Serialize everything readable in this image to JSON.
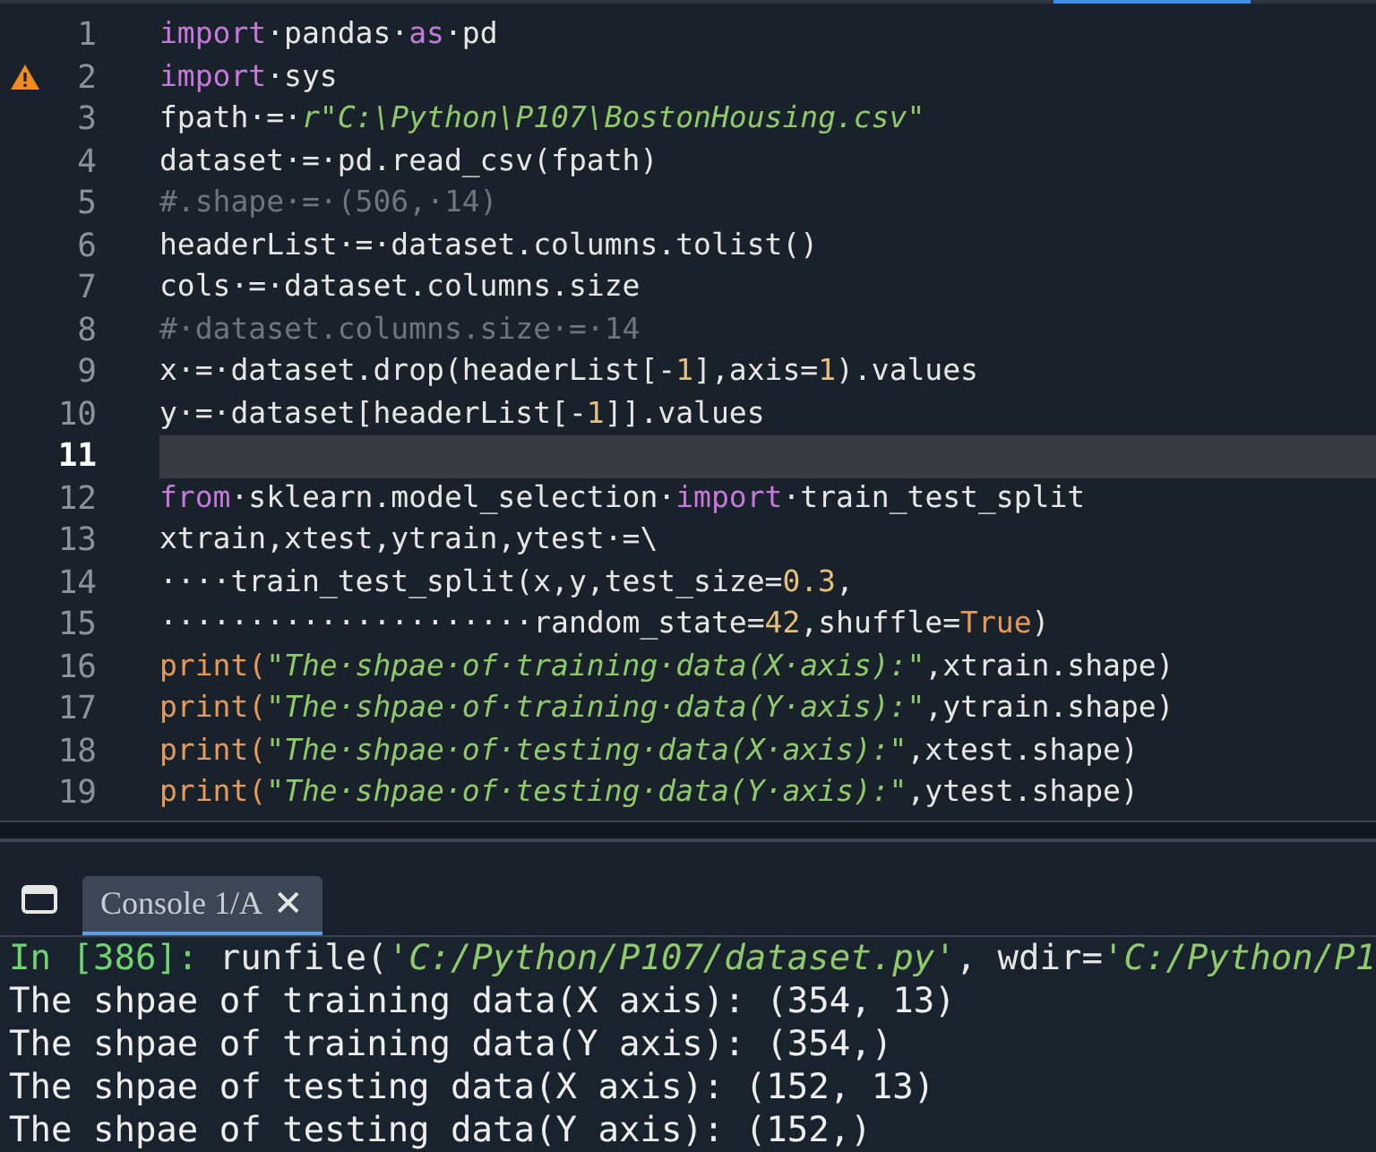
{
  "editor": {
    "lines": [
      {
        "number": "1",
        "warning": false,
        "current": false,
        "tokens": [
          {
            "kind": "keyword",
            "text": "import"
          },
          {
            "kind": "plain",
            "text": "·pandas·"
          },
          {
            "kind": "keyword",
            "text": "as"
          },
          {
            "kind": "plain",
            "text": "·pd"
          }
        ]
      },
      {
        "number": "2",
        "warning": true,
        "current": false,
        "tokens": [
          {
            "kind": "keyword",
            "text": "import"
          },
          {
            "kind": "plain",
            "text": "·sys"
          }
        ]
      },
      {
        "number": "3",
        "warning": false,
        "current": false,
        "tokens": [
          {
            "kind": "plain",
            "text": "fpath·=·"
          },
          {
            "kind": "string",
            "text": "r\"C:\\Python\\P107\\BostonHousing.csv\""
          }
        ]
      },
      {
        "number": "4",
        "warning": false,
        "current": false,
        "tokens": [
          {
            "kind": "plain",
            "text": "dataset·=·pd.read_csv(fpath)"
          }
        ]
      },
      {
        "number": "5",
        "warning": false,
        "current": false,
        "tokens": [
          {
            "kind": "comment",
            "text": "#.shape·=·(506,·14)"
          }
        ]
      },
      {
        "number": "6",
        "warning": false,
        "current": false,
        "tokens": [
          {
            "kind": "plain",
            "text": "headerList·=·dataset.columns.tolist()"
          }
        ]
      },
      {
        "number": "7",
        "warning": false,
        "current": false,
        "tokens": [
          {
            "kind": "plain",
            "text": "cols·=·dataset.columns.size"
          }
        ]
      },
      {
        "number": "8",
        "warning": false,
        "current": false,
        "tokens": [
          {
            "kind": "comment",
            "text": "#·dataset.columns.size·=·14"
          }
        ]
      },
      {
        "number": "9",
        "warning": false,
        "current": false,
        "tokens": [
          {
            "kind": "plain",
            "text": "x·=·dataset.drop(headerList[-"
          },
          {
            "kind": "number",
            "text": "1"
          },
          {
            "kind": "plain",
            "text": "],axis="
          },
          {
            "kind": "number",
            "text": "1"
          },
          {
            "kind": "plain",
            "text": ").values"
          }
        ]
      },
      {
        "number": "10",
        "warning": false,
        "current": false,
        "tokens": [
          {
            "kind": "plain",
            "text": "y·=·dataset[headerList[-"
          },
          {
            "kind": "number",
            "text": "1"
          },
          {
            "kind": "plain",
            "text": "]].values"
          }
        ]
      },
      {
        "number": "11",
        "warning": false,
        "current": true
      },
      {
        "number": "12",
        "warning": false,
        "current": false,
        "tokens": [
          {
            "kind": "keyword",
            "text": "from"
          },
          {
            "kind": "plain",
            "text": "·sklearn.model_selection·"
          },
          {
            "kind": "keyword",
            "text": "import"
          },
          {
            "kind": "plain",
            "text": "·train_test_split"
          }
        ]
      },
      {
        "number": "13",
        "warning": false,
        "current": false,
        "tokens": [
          {
            "kind": "plain",
            "text": "xtrain,xtest,ytrain,ytest·=\\"
          }
        ]
      },
      {
        "number": "14",
        "warning": false,
        "current": false,
        "tokens": [
          {
            "kind": "plain",
            "text": "····train_test_split(x,y,test_size="
          },
          {
            "kind": "number",
            "text": "0.3"
          },
          {
            "kind": "plain",
            "text": ","
          }
        ]
      },
      {
        "number": "15",
        "warning": false,
        "current": false,
        "tokens": [
          {
            "kind": "plain",
            "text": "·····················random_state="
          },
          {
            "kind": "number",
            "text": "42"
          },
          {
            "kind": "plain",
            "text": ",shuffle="
          },
          {
            "kind": "builtin",
            "text": "True"
          },
          {
            "kind": "plain",
            "text": ")"
          }
        ]
      },
      {
        "number": "16",
        "warning": false,
        "current": false,
        "tokens": [
          {
            "kind": "builtin",
            "text": "print("
          },
          {
            "kind": "string",
            "text": "\"The·shpae·of·training·data(X·axis):\""
          },
          {
            "kind": "plain",
            "text": ",xtrain.shape)"
          }
        ]
      },
      {
        "number": "17",
        "warning": false,
        "current": false,
        "tokens": [
          {
            "kind": "builtin",
            "text": "print("
          },
          {
            "kind": "string",
            "text": "\"The·shpae·of·training·data(Y·axis):\""
          },
          {
            "kind": "plain",
            "text": ",ytrain.shape)"
          }
        ]
      },
      {
        "number": "18",
        "warning": false,
        "current": false,
        "tokens": [
          {
            "kind": "builtin",
            "text": "print("
          },
          {
            "kind": "string",
            "text": "\"The·shpae·of·testing·data(X·axis):\""
          },
          {
            "kind": "plain",
            "text": ",xtest.shape)"
          }
        ]
      },
      {
        "number": "19",
        "warning": false,
        "current": false,
        "tokens": [
          {
            "kind": "builtin",
            "text": "print("
          },
          {
            "kind": "string",
            "text": "\"The·shpae·of·testing·data(Y·axis):\""
          },
          {
            "kind": "plain",
            "text": ",ytest.shape)"
          }
        ]
      }
    ]
  },
  "console": {
    "tabs": [
      {
        "label": "Console 1/A",
        "close": "✕",
        "selected": true
      }
    ],
    "command": [
      {
        "kind": "prompt",
        "text": "In [386]: "
      },
      {
        "kind": "plain",
        "text": "runfile("
      },
      {
        "kind": "string",
        "text": "'C:/Python/P107/dataset.py'"
      },
      {
        "kind": "plain",
        "text": ", wdir="
      },
      {
        "kind": "string",
        "text": "'C:/Python/P1"
      }
    ],
    "output": [
      "The shpae of training data(X axis): (354, 13)",
      "The shpae of training data(Y axis): (354,)",
      "The shpae of testing data(X axis): (152, 13)",
      "The shpae of testing data(Y axis): (152,)"
    ]
  }
}
